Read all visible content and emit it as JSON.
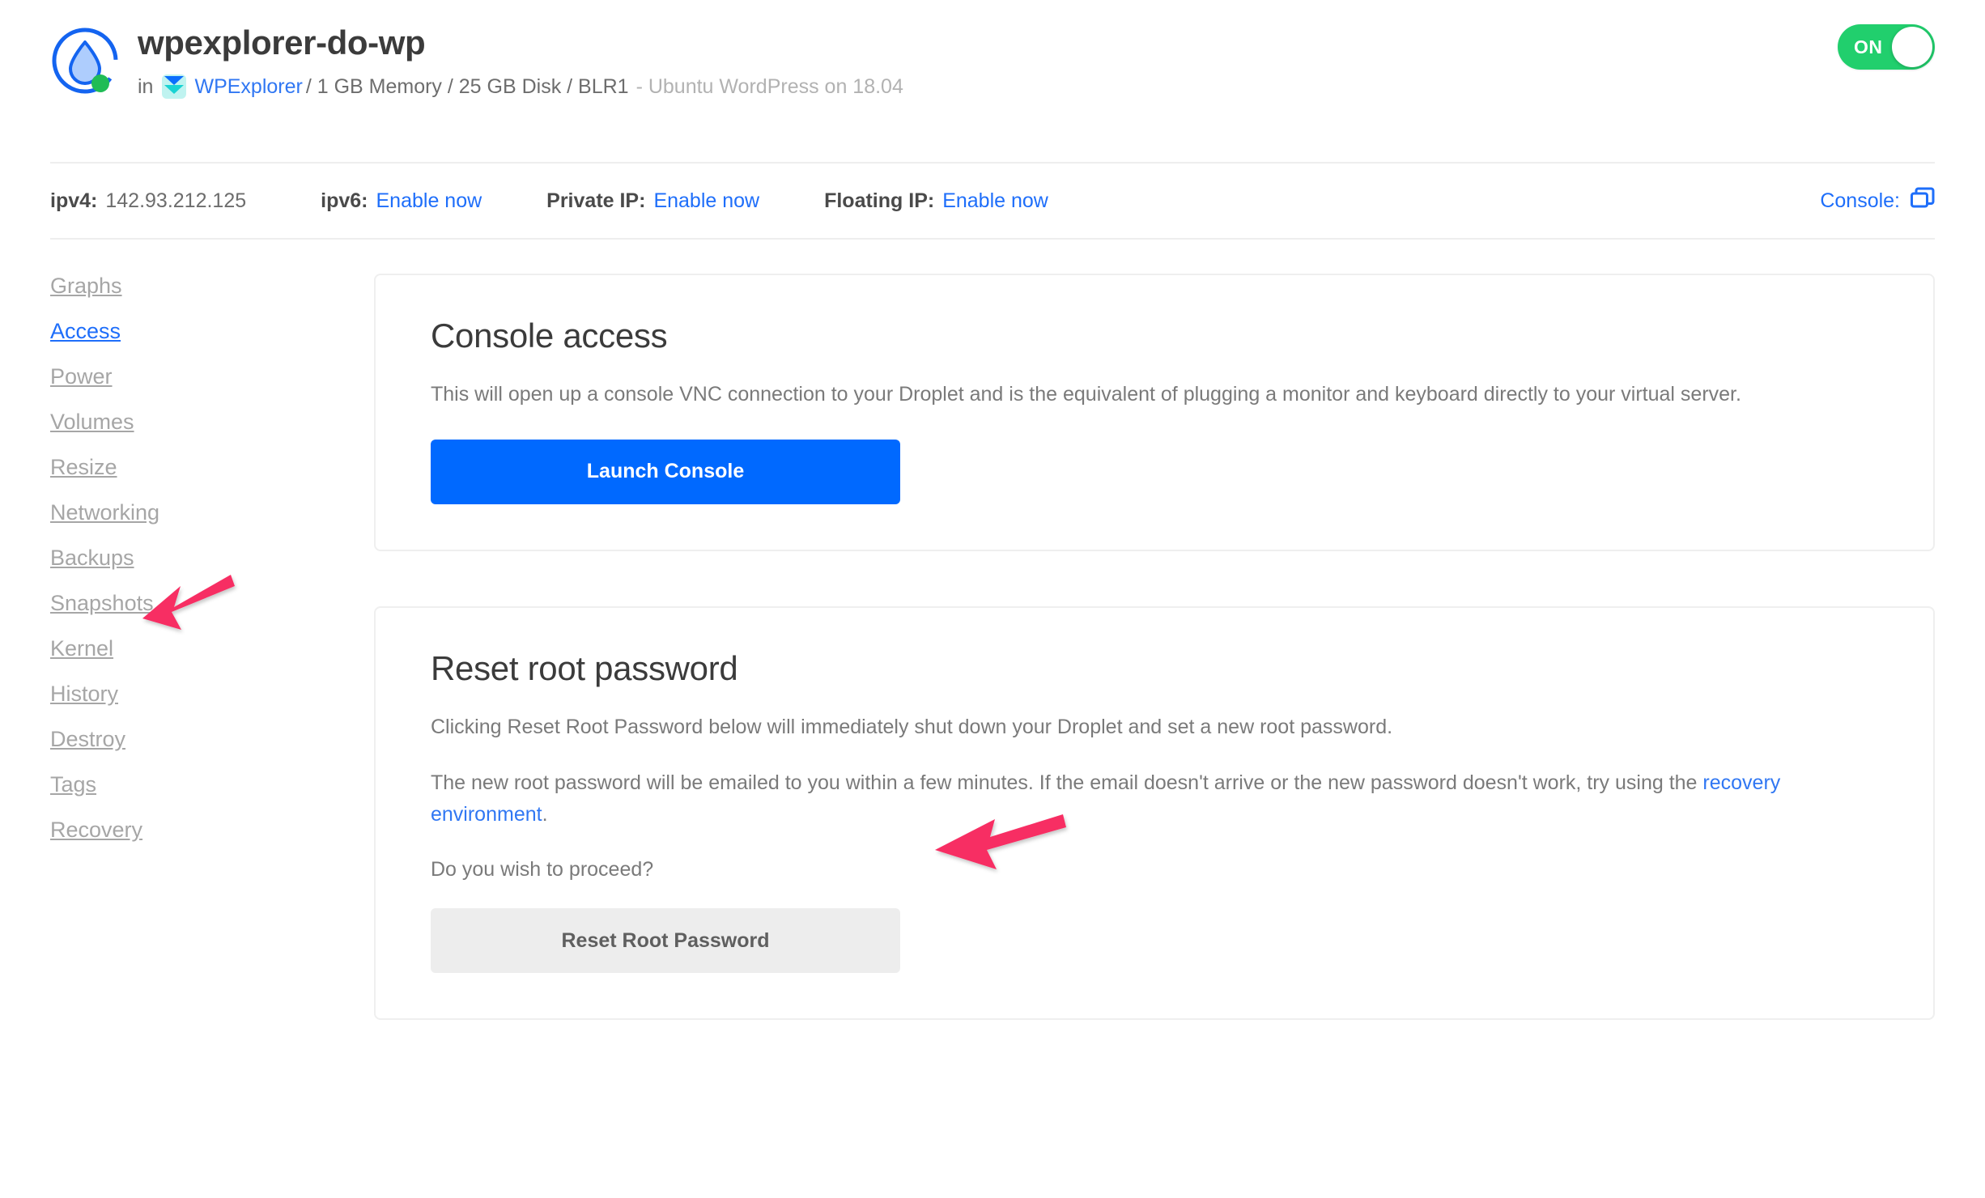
{
  "header": {
    "droplet_name": "wpexplorer-do-wp",
    "in_label": "in",
    "project_name": "WPExplorer",
    "specs": "/ 1 GB Memory / 25 GB Disk / BLR1",
    "os": "- Ubuntu WordPress on 18.04",
    "power_toggle_label": "ON",
    "logo_icon": "droplet-icon",
    "status_icon": "status-dot-online",
    "project_icon": "project-chevrons-icon"
  },
  "ipbar": {
    "ipv4_label": "ipv4:",
    "ipv4_value": "142.93.212.125",
    "ipv6_label": "ipv6:",
    "ipv6_action": "Enable now",
    "private_ip_label": "Private IP:",
    "private_ip_action": "Enable now",
    "floating_ip_label": "Floating IP:",
    "floating_ip_action": "Enable now",
    "console_label": "Console:",
    "console_icon": "external-window-icon"
  },
  "sidebar": {
    "items": [
      {
        "label": "Graphs",
        "active": false
      },
      {
        "label": "Access",
        "active": true
      },
      {
        "label": "Power",
        "active": false
      },
      {
        "label": "Volumes",
        "active": false
      },
      {
        "label": "Resize",
        "active": false
      },
      {
        "label": "Networking",
        "active": false
      },
      {
        "label": "Backups",
        "active": false
      },
      {
        "label": "Snapshots",
        "active": false
      },
      {
        "label": "Kernel",
        "active": false
      },
      {
        "label": "History",
        "active": false
      },
      {
        "label": "Destroy",
        "active": false
      },
      {
        "label": "Tags",
        "active": false
      },
      {
        "label": "Recovery",
        "active": false
      }
    ]
  },
  "console_card": {
    "title": "Console access",
    "description": "This will open up a console VNC connection to your Droplet and is the equivalent of plugging a monitor and keyboard directly to your virtual server.",
    "button_label": "Launch Console"
  },
  "reset_card": {
    "title": "Reset root password",
    "paragraph1": "Clicking Reset Root Password below will immediately shut down your Droplet and set a new root password.",
    "paragraph2_before": "The new root password will be emailed to you within a few minutes. If the email doesn't arrive or the new password doesn't work, try using the ",
    "paragraph2_link": "recovery environment",
    "paragraph2_after": ".",
    "paragraph3": "Do you wish to proceed?",
    "button_label": "Reset Root Password"
  },
  "annotations": {
    "arrow_color": "#f72e63",
    "arrow_sidebar_target": "Access",
    "arrow_launch_target": "Launch Console"
  },
  "colors": {
    "primary_blue": "#0069ff",
    "link_blue": "#3077f3",
    "toggle_green": "#21cf6d",
    "annotation_pink": "#f72e63",
    "card_border": "#efefef",
    "muted_text": "#a6a6a6"
  }
}
